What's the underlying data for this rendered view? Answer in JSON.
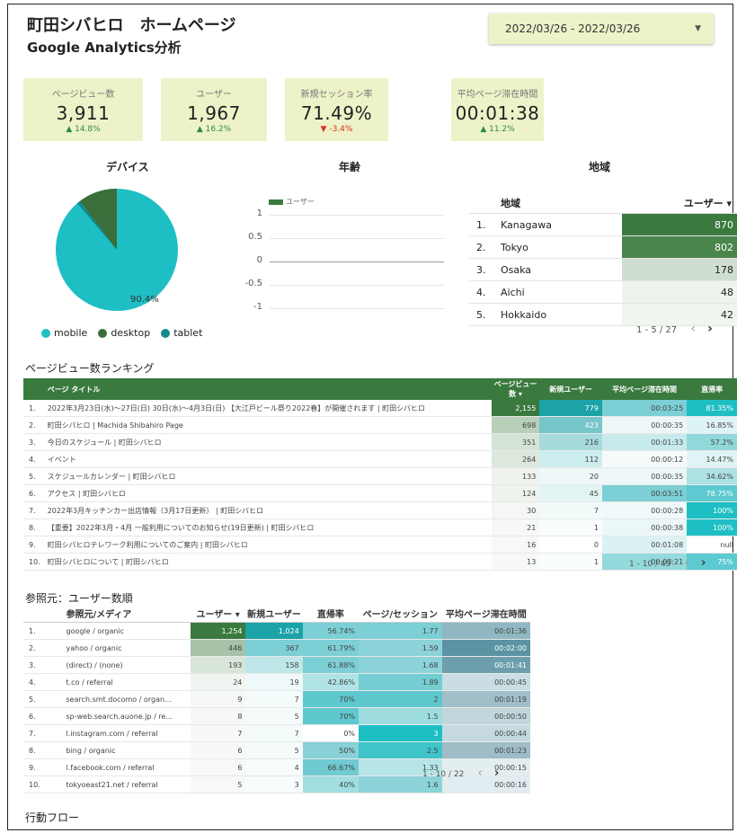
{
  "header": {
    "title": "町田シバヒロ　ホームページ",
    "subtitle": "Google Analytics分析"
  },
  "date_range": {
    "value": "2022/03/26 - 2022/03/26",
    "arrow": "▼"
  },
  "kpis": [
    {
      "label": "ページビュー数",
      "value": "3,911",
      "change": "▲ 14.8%",
      "dir": "up"
    },
    {
      "label": "ユーザー",
      "value": "1,967",
      "change": "▲ 16.2%",
      "dir": "up"
    },
    {
      "label": "新規セッション率",
      "value": "71.49%",
      "change": "▼ -3.4%",
      "dir": "down"
    },
    {
      "label": "平均ページ滞在時間",
      "value": "00:01:38",
      "change": "▲ 11.2%",
      "dir": "up"
    }
  ],
  "device": {
    "title": "デバイス",
    "slice_label": "90.4%",
    "legend": [
      {
        "name": "mobile",
        "color": "#1ebfc4"
      },
      {
        "name": "desktop",
        "color": "#3a6e3b"
      },
      {
        "name": "tablet",
        "color": "#15898c"
      }
    ]
  },
  "age": {
    "title": "年齢",
    "legend": "ユーザー",
    "yticks": [
      "1",
      "0.5",
      "0",
      "-0.5",
      "-1"
    ]
  },
  "region": {
    "title": "地域",
    "col_region": "地域",
    "col_users": "ユーザー ▾",
    "rows": [
      {
        "no": "1.",
        "name": "Kanagawa",
        "users": "870"
      },
      {
        "no": "2.",
        "name": "Tokyo",
        "users": "802"
      },
      {
        "no": "3.",
        "name": "Osaka",
        "users": "178"
      },
      {
        "no": "4.",
        "name": "Aichi",
        "users": "48"
      },
      {
        "no": "5.",
        "name": "Hokkaido",
        "users": "42"
      }
    ],
    "pager": "1 - 5 / 27"
  },
  "ranking": {
    "title": "ページビュー数ランキング",
    "headers": [
      "ページ タイトル",
      "ページビュー数 ▾",
      "新規ユーザー",
      "平均ページ滞在時間",
      "直帰率"
    ],
    "rows": [
      {
        "no": "1.",
        "title": "2022年3月23日(水)～27日(日) 30日(水)～4月3日(日) 【大江戸ビール祭り2022春】が開催されます | 町田シバヒロ",
        "pv": "2,155",
        "nu": "779",
        "time": "00:03:25",
        "bounce": "81.35%"
      },
      {
        "no": "2.",
        "title": "町田シバヒロ | Machida Shibahiro Page",
        "pv": "698",
        "nu": "423",
        "time": "00:00:35",
        "bounce": "16.85%"
      },
      {
        "no": "3.",
        "title": "今日のスケジュール | 町田シバヒロ",
        "pv": "351",
        "nu": "216",
        "time": "00:01:33",
        "bounce": "57.2%"
      },
      {
        "no": "4.",
        "title": "イベント",
        "pv": "264",
        "nu": "112",
        "time": "00:00:12",
        "bounce": "14.47%"
      },
      {
        "no": "5.",
        "title": "スケジュールカレンダー | 町田シバヒロ",
        "pv": "133",
        "nu": "20",
        "time": "00:00:35",
        "bounce": "34.62%"
      },
      {
        "no": "6.",
        "title": "アクセス | 町田シバヒロ",
        "pv": "124",
        "nu": "45",
        "time": "00:03:51",
        "bounce": "78.75%"
      },
      {
        "no": "7.",
        "title": "2022年3月キッチンカー出店情報（3月17日更新） | 町田シバヒロ",
        "pv": "30",
        "nu": "7",
        "time": "00:00:28",
        "bounce": "100%"
      },
      {
        "no": "8.",
        "title": "【重要】2022年3月・4月 一般利用についてのお知らせ(19日更新) | 町田シバヒロ",
        "pv": "21",
        "nu": "1",
        "time": "00:00:38",
        "bounce": "100%"
      },
      {
        "no": "9.",
        "title": "町田シバヒロテレワーク利用についてのご案内 | 町田シバヒロ",
        "pv": "16",
        "nu": "0",
        "time": "00:01:08",
        "bounce": "null"
      },
      {
        "no": "10.",
        "title": "町田シバヒロについて | 町田シバヒロ",
        "pv": "13",
        "nu": "1",
        "time": "00:03:21",
        "bounce": "75%"
      }
    ],
    "pager": "1 - 10 / 45"
  },
  "referral": {
    "title": "参照元：ユーザー数順",
    "headers": [
      "参照元/メディア",
      "ユーザー ▾",
      "新規ユーザー",
      "直帰率",
      "ページ/セッション",
      "平均ページ滞在時間"
    ],
    "rows": [
      {
        "no": "1.",
        "src": "google / organic",
        "users": "1,254",
        "nu": "1,024",
        "bounce": "56.74%",
        "pps": "1.77",
        "time": "00:01:36"
      },
      {
        "no": "2.",
        "src": "yahoo / organic",
        "users": "446",
        "nu": "367",
        "bounce": "61.79%",
        "pps": "1.59",
        "time": "00:02:00"
      },
      {
        "no": "3.",
        "src": "(direct) / (none)",
        "users": "193",
        "nu": "158",
        "bounce": "61.88%",
        "pps": "1.68",
        "time": "00:01:41"
      },
      {
        "no": "4.",
        "src": "t.co / referral",
        "users": "24",
        "nu": "19",
        "bounce": "42.86%",
        "pps": "1.89",
        "time": "00:00:45"
      },
      {
        "no": "5.",
        "src": "search.smt.docomo / organ...",
        "users": "9",
        "nu": "7",
        "bounce": "70%",
        "pps": "2",
        "time": "00:01:19"
      },
      {
        "no": "6.",
        "src": "sp-web.search.auone.jp / re...",
        "users": "8",
        "nu": "5",
        "bounce": "70%",
        "pps": "1.5",
        "time": "00:00:50"
      },
      {
        "no": "7.",
        "src": "l.instagram.com / referral",
        "users": "7",
        "nu": "7",
        "bounce": "0%",
        "pps": "3",
        "time": "00:00:44"
      },
      {
        "no": "8.",
        "src": "bing / organic",
        "users": "6",
        "nu": "5",
        "bounce": "50%",
        "pps": "2.5",
        "time": "00:01:23"
      },
      {
        "no": "9.",
        "src": "l.facebook.com / referral",
        "users": "6",
        "nu": "4",
        "bounce": "66.67%",
        "pps": "1.33",
        "time": "00:00:15"
      },
      {
        "no": "10.",
        "src": "tokyoeast21.net / referral",
        "users": "5",
        "nu": "3",
        "bounce": "40%",
        "pps": "1.6",
        "time": "00:00:16"
      }
    ],
    "pager": "1 - 10 / 22"
  },
  "flow": {
    "title": "行動フロー"
  },
  "pager_icons": {
    "prev": "‹",
    "next": "›"
  }
}
